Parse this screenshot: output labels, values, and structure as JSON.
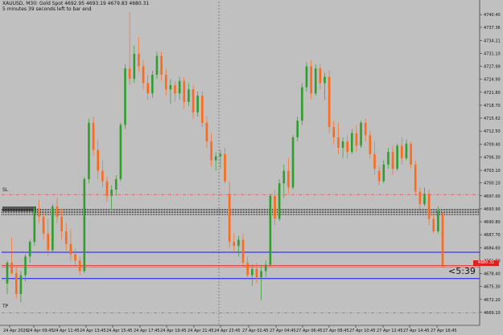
{
  "header": {
    "title": "XAUUSD, M30:  Gold Spot  4692.95 4693.19 4679.83 4680.31",
    "subtitle": "5 minutes 39 seconds left to bar end"
  },
  "annotations": {
    "sl": "SL",
    "tp": "TP",
    "countdown": "<5:39",
    "current_price": "4680.31"
  },
  "colors": {
    "background": "#c0c0c0",
    "bull": "#2f9e2f",
    "bear": "#ff6a1a",
    "sl_line": "#e05050",
    "tp_line": "#e05050",
    "range_line": "#1414ff",
    "price_tag": "#e02020"
  },
  "levels": {
    "sl": 4697.3,
    "tp": 4669.0,
    "black_band": 4693.3,
    "blue_upper": 4683.5,
    "blue_lower": 4677.2,
    "red_price": 4680.3
  },
  "chart_data": {
    "type": "candlestick",
    "ylim": [
      4666.0,
      4743.5
    ],
    "y_ticks": [
      "4740.40",
      "4737.36",
      "4734.21",
      "4731.10",
      "4727.99",
      "4724.90",
      "4721.80",
      "4718.70",
      "4715.62",
      "4712.50",
      "4709.40",
      "4706.30",
      "4703.10",
      "4700.10",
      "4697.00",
      "4693.90",
      "4690.80",
      "4687.70",
      "4684.60",
      "4681.50",
      "4678.40",
      "4675.30",
      "4672.20",
      "4669.10"
    ],
    "x_ticks": [
      "24 Apr 2026",
      "24 Apr 09:45",
      "24 Apr 11:45",
      "24 Apr 13:45",
      "24 Apr 15:45",
      "24 Apr 17:45",
      "24 Apr 19:45",
      "24 Apr 21:45",
      "24 Apr 23:45",
      "27 Apr 02:45",
      "27 Apr 04:45",
      "27 Apr 06:45",
      "27 Apr 08:45",
      "27 Apr 10:45",
      "27 Apr 12:45",
      "27 Apr 14:45",
      "27 Apr 16:45"
    ],
    "candles": [
      [
        4676.0,
        4681.5,
        4673.5,
        4681.0
      ],
      [
        4681.0,
        4687.0,
        4678.0,
        4678.5
      ],
      [
        4678.5,
        4680.0,
        4672.5,
        4673.5
      ],
      [
        4673.5,
        4679.0,
        4671.5,
        4678.0
      ],
      [
        4678.0,
        4683.0,
        4676.5,
        4682.5
      ],
      [
        4682.5,
        4686.5,
        4681.0,
        4686.0
      ],
      [
        4686.0,
        4694.5,
        4685.0,
        4694.0
      ],
      [
        4694.0,
        4696.0,
        4690.5,
        4692.0
      ],
      [
        4692.0,
        4693.0,
        4686.5,
        4688.0
      ],
      [
        4688.0,
        4691.5,
        4682.5,
        4684.0
      ],
      [
        4684.0,
        4695.0,
        4683.5,
        4694.5
      ],
      [
        4694.5,
        4696.5,
        4690.5,
        4692.0
      ],
      [
        4692.0,
        4694.0,
        4686.5,
        4688.5
      ],
      [
        4688.5,
        4690.5,
        4684.0,
        4685.5
      ],
      [
        4685.5,
        4689.0,
        4681.5,
        4683.0
      ],
      [
        4683.0,
        4684.5,
        4680.0,
        4681.5
      ],
      [
        4681.5,
        4682.5,
        4678.0,
        4679.0
      ],
      [
        4679.0,
        4701.5,
        4678.5,
        4701.0
      ],
      [
        4701.0,
        4715.5,
        4700.0,
        4714.5
      ],
      [
        4714.5,
        4716.0,
        4706.5,
        4708.0
      ],
      [
        4708.0,
        4710.5,
        4701.0,
        4703.0
      ],
      [
        4703.0,
        4705.5,
        4699.0,
        4700.5
      ],
      [
        4700.5,
        4701.5,
        4695.5,
        4697.0
      ],
      [
        4697.0,
        4699.5,
        4693.5,
        4698.5
      ],
      [
        4698.5,
        4702.0,
        4697.0,
        4701.0
      ],
      [
        4701.0,
        4714.5,
        4700.5,
        4714.0
      ],
      [
        4714.0,
        4728.5,
        4713.0,
        4727.5
      ],
      [
        4727.5,
        4741.0,
        4723.5,
        4725.0
      ],
      [
        4725.0,
        4733.0,
        4724.0,
        4731.0
      ],
      [
        4731.0,
        4735.0,
        4726.5,
        4728.0
      ],
      [
        4728.0,
        4729.5,
        4722.5,
        4724.0
      ],
      [
        4724.0,
        4726.0,
        4720.0,
        4721.5
      ],
      [
        4721.5,
        4727.0,
        4720.5,
        4726.0
      ],
      [
        4726.0,
        4731.5,
        4725.0,
        4730.5
      ],
      [
        4730.5,
        4731.5,
        4724.5,
        4726.0
      ],
      [
        4726.0,
        4727.5,
        4721.0,
        4722.5
      ],
      [
        4722.5,
        4725.0,
        4719.0,
        4723.5
      ],
      [
        4723.5,
        4724.5,
        4719.5,
        4721.5
      ],
      [
        4721.5,
        4725.5,
        4720.0,
        4724.5
      ],
      [
        4724.5,
        4725.5,
        4718.0,
        4719.5
      ],
      [
        4719.5,
        4724.0,
        4718.5,
        4722.5
      ],
      [
        4722.5,
        4723.5,
        4715.5,
        4717.0
      ],
      [
        4717.0,
        4722.0,
        4716.0,
        4721.0
      ],
      [
        4721.0,
        4722.0,
        4713.5,
        4714.5
      ],
      [
        4714.5,
        4716.0,
        4708.5,
        4710.0
      ],
      [
        4710.0,
        4712.0,
        4704.0,
        4705.5
      ],
      [
        4705.5,
        4707.5,
        4703.0,
        4706.5
      ],
      [
        4706.5,
        4708.0,
        4703.5,
        4707.0
      ],
      [
        4707.0,
        4708.5,
        4700.0,
        4700.5
      ],
      [
        4697.5,
        4700.5,
        4684.5,
        4686.0
      ],
      [
        4686.0,
        4688.0,
        4683.5,
        4685.0
      ],
      [
        4685.0,
        4687.5,
        4682.5,
        4686.5
      ],
      [
        4686.5,
        4688.0,
        4680.0,
        4681.0
      ],
      [
        4681.0,
        4682.5,
        4677.0,
        4678.0
      ],
      [
        4678.0,
        4680.5,
        4675.5,
        4679.5
      ],
      [
        4679.5,
        4681.0,
        4676.0,
        4677.5
      ],
      [
        4677.5,
        4680.5,
        4672.0,
        4679.0
      ],
      [
        4679.0,
        4681.5,
        4677.5,
        4680.5
      ],
      [
        4680.5,
        4697.5,
        4680.0,
        4697.0
      ],
      [
        4697.0,
        4698.5,
        4690.0,
        4691.5
      ],
      [
        4691.5,
        4701.0,
        4691.0,
        4700.0
      ],
      [
        4700.0,
        4704.5,
        4696.5,
        4703.0
      ],
      [
        4703.0,
        4706.0,
        4697.5,
        4699.0
      ],
      [
        4699.0,
        4711.5,
        4698.5,
        4711.0
      ],
      [
        4711.0,
        4716.0,
        4710.0,
        4715.0
      ],
      [
        4715.0,
        4724.0,
        4714.0,
        4723.0
      ],
      [
        4723.0,
        4729.0,
        4722.0,
        4728.0
      ],
      [
        4728.0,
        4729.5,
        4720.0,
        4721.5
      ],
      [
        4721.5,
        4728.5,
        4721.0,
        4727.5
      ],
      [
        4727.5,
        4728.5,
        4722.5,
        4724.0
      ],
      [
        4724.0,
        4726.5,
        4720.0,
        4725.5
      ],
      [
        4725.5,
        4727.0,
        4712.0,
        4713.5
      ],
      [
        4713.5,
        4715.0,
        4709.5,
        4711.0
      ],
      [
        4711.0,
        4714.5,
        4707.0,
        4708.5
      ],
      [
        4708.5,
        4711.0,
        4706.0,
        4710.0
      ],
      [
        4710.0,
        4711.5,
        4706.0,
        4707.5
      ],
      [
        4707.5,
        4713.0,
        4707.0,
        4712.0
      ],
      [
        4712.0,
        4714.0,
        4707.5,
        4709.0
      ],
      [
        4709.0,
        4715.0,
        4708.5,
        4714.5
      ],
      [
        4714.5,
        4715.5,
        4710.0,
        4711.5
      ],
      [
        4711.5,
        4712.5,
        4706.0,
        4707.0
      ],
      [
        4707.0,
        4710.0,
        4702.0,
        4703.5
      ],
      [
        4703.0,
        4704.0,
        4699.5,
        4700.5
      ],
      [
        4700.5,
        4705.5,
        4700.0,
        4704.5
      ],
      [
        4704.5,
        4708.5,
        4703.5,
        4707.5
      ],
      [
        4707.5,
        4709.0,
        4702.0,
        4703.5
      ],
      [
        4703.5,
        4709.5,
        4703.0,
        4709.0
      ],
      [
        4709.0,
        4711.0,
        4704.5,
        4706.0
      ],
      [
        4706.0,
        4710.5,
        4705.5,
        4709.5
      ],
      [
        4709.5,
        4710.0,
        4703.5,
        4704.5
      ],
      [
        4704.5,
        4705.5,
        4697.0,
        4698.0
      ],
      [
        4698.0,
        4699.0,
        4693.5,
        4695.0
      ],
      [
        4695.0,
        4699.0,
        4694.5,
        4697.5
      ],
      [
        4697.5,
        4698.5,
        4690.0,
        4691.5
      ],
      [
        4691.5,
        4692.5,
        4688.0,
        4688.5
      ],
      [
        4688.5,
        4694.5,
        4688.0,
        4693.5
      ],
      [
        4692.9,
        4693.2,
        4679.8,
        4680.3
      ]
    ]
  }
}
